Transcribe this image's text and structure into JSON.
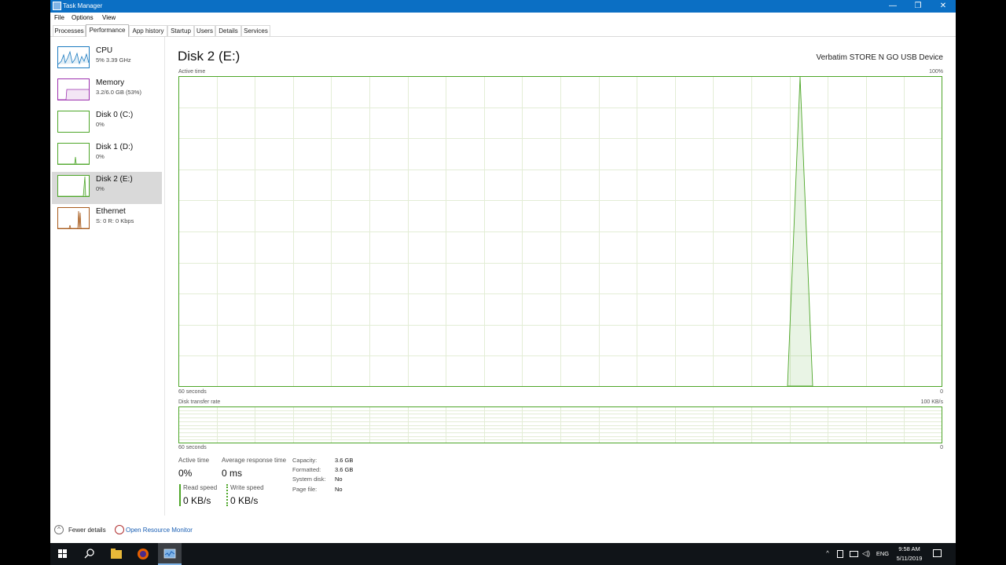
{
  "window": {
    "title": "Task Manager",
    "controls": {
      "minimize": "—",
      "restore": "❐",
      "close": "✕"
    }
  },
  "menu": [
    "File",
    "Options",
    "View"
  ],
  "tabs": [
    "Processes",
    "Performance",
    "App history",
    "Startup",
    "Users",
    "Details",
    "Services"
  ],
  "active_tab": "Performance",
  "sidebar": {
    "items": [
      {
        "name": "CPU",
        "sub": "5% 3.39 GHz",
        "color": "#1c7bc0"
      },
      {
        "name": "Memory",
        "sub": "3.2/6.0 GB (53%)",
        "color": "#9b2fae"
      },
      {
        "name": "Disk 0 (C:)",
        "sub": "0%",
        "color": "#4da628"
      },
      {
        "name": "Disk 1 (D:)",
        "sub": "0%",
        "color": "#4da628"
      },
      {
        "name": "Disk 2 (E:)",
        "sub": "0%",
        "color": "#4da628"
      },
      {
        "name": "Ethernet",
        "sub": "S: 0 R: 0 Kbps",
        "color": "#a75a1b"
      }
    ],
    "selected": "Disk 2 (E:)"
  },
  "main": {
    "title": "Disk 2 (E:)",
    "device": "Verbatim STORE N GO USB Device",
    "active_graph": {
      "label": "Active time",
      "max_label": "100%",
      "time_label": "60 seconds",
      "min_label": "0"
    },
    "transfer_graph": {
      "label": "Disk transfer rate",
      "max_label": "100 KB/s",
      "time_label": "60 seconds",
      "min_label": "0"
    },
    "stats": {
      "active_time": {
        "label": "Active time",
        "value": "0%"
      },
      "avg_response": {
        "label": "Average response time",
        "value": "0 ms"
      },
      "read_speed": {
        "label": "Read speed",
        "value": "0 KB/s"
      },
      "write_speed": {
        "label": "Write speed",
        "value": "0 KB/s"
      }
    },
    "properties": [
      {
        "label": "Capacity:",
        "value": "3.6 GB"
      },
      {
        "label": "Formatted:",
        "value": "3.6 GB"
      },
      {
        "label": "System disk:",
        "value": "No"
      },
      {
        "label": "Page file:",
        "value": "No"
      }
    ]
  },
  "footer": {
    "fewer_details": "Fewer details",
    "resource_monitor": "Open Resource Monitor"
  },
  "taskbar": {
    "language": "ENG",
    "time": "9:58 AM",
    "date": "5/11/2019"
  },
  "colors": {
    "accent": "#0b6fc4",
    "disk": "#4da628",
    "grid": "#e3edd6"
  }
}
